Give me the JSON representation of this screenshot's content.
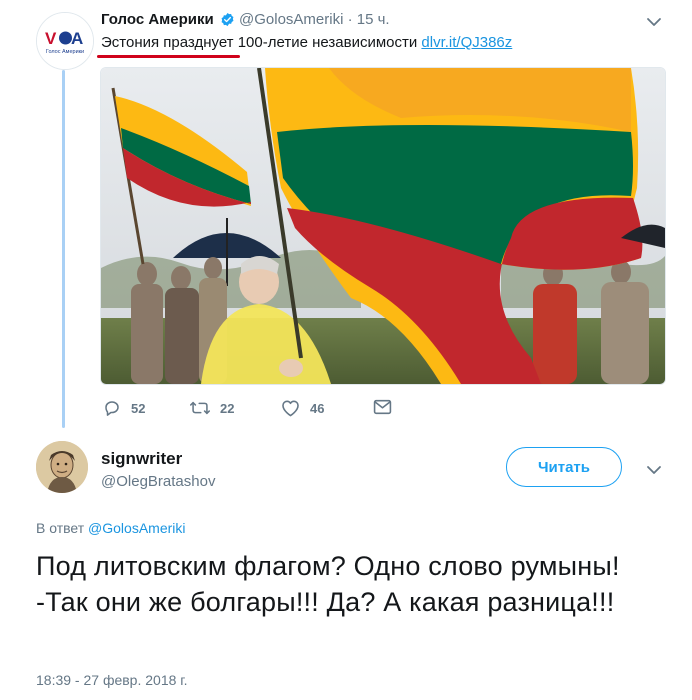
{
  "quoted_tweet": {
    "author_name": "Голос Америки",
    "author_handle": "@GolosAmeriki",
    "time_ago": "· 15 ч.",
    "text_highlighted": "Эстония празднует",
    "text_rest": " 100-летие независимости ",
    "link_text": "dlvr.it/QJ386z",
    "avatar_logo_text": "VOA",
    "avatar_logo_sub": "Голос Америки",
    "photo_description_icon": "flags-photo",
    "counts": {
      "replies": "52",
      "retweets": "22",
      "likes": "46"
    }
  },
  "reply_tweet": {
    "author_name": "signwriter",
    "author_handle": "@OlegBratashov",
    "follow_label": "Читать",
    "reply_to_prefix": "В ответ ",
    "reply_to_handle": "@GolosAmeriki",
    "text": "Под литовским флагом? Одно слово румыны! -Так они же болгары!!! Да? А какая разница!!!",
    "timestamp": "18:39 - 27 февр. 2018 г."
  },
  "colors": {
    "accent": "#1da1f2",
    "link": "#1b95e0",
    "muted": "#657786",
    "highlight_underline": "#d0021b",
    "flag_yellow": "#fdb913",
    "flag_green": "#006a44",
    "flag_red": "#c1272d"
  },
  "icons": [
    "verified-icon",
    "chevron-down-icon",
    "reply-icon",
    "retweet-icon",
    "like-icon",
    "message-icon"
  ]
}
